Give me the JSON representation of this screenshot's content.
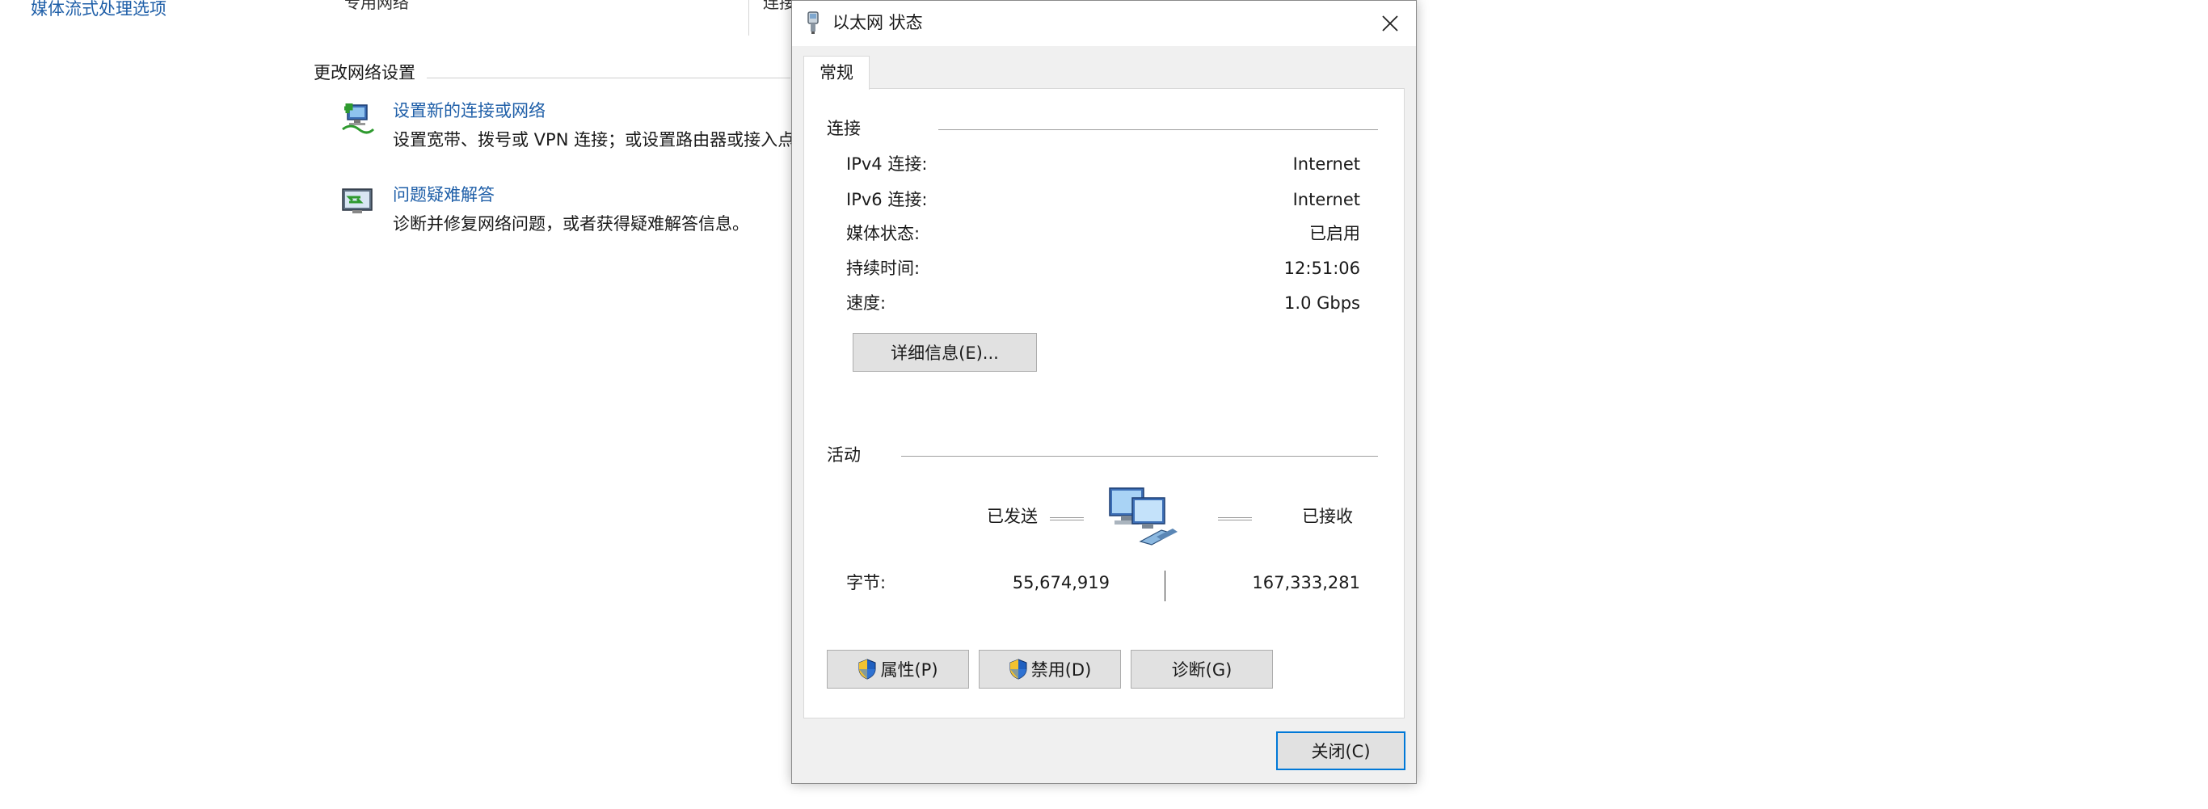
{
  "background": {
    "sidebar_link": "媒体流式处理选项",
    "network_name": "专用网络",
    "connect_label": "连接",
    "section_title": "更改网络设置",
    "items": [
      {
        "link": "设置新的连接或网络",
        "desc": "设置宽带、拨号或 VPN 连接；或设置路由器或接入点。",
        "icon": "network-setup-icon"
      },
      {
        "link": "问题疑难解答",
        "desc": "诊断并修复网络问题，或者获得疑难解答信息。",
        "icon": "troubleshoot-icon"
      }
    ]
  },
  "dialog": {
    "title": "以太网 状态",
    "tab": "常规",
    "connection": {
      "label": "连接",
      "rows": [
        {
          "label": "IPv4 连接:",
          "value": "Internet"
        },
        {
          "label": "IPv6 连接:",
          "value": "Internet"
        },
        {
          "label": "媒体状态:",
          "value": "已启用"
        },
        {
          "label": "持续时间:",
          "value": "12:51:06"
        },
        {
          "label": "速度:",
          "value": "1.0 Gbps"
        }
      ],
      "details_button": "详细信息(E)..."
    },
    "activity": {
      "label": "活动",
      "sent_label": "已发送",
      "received_label": "已接收",
      "bytes_label": "字节:",
      "bytes_sent": "55,674,919",
      "bytes_received": "167,333,281"
    },
    "buttons": {
      "properties": "属性(P)",
      "disable": "禁用(D)",
      "diagnose": "诊断(G)",
      "close": "关闭(C)"
    }
  },
  "colors": {
    "link": "#1f5fa8",
    "dialog_bg": "#f0f0f0",
    "button_bg": "#e1e1e1",
    "focus_border": "#0078d7"
  }
}
